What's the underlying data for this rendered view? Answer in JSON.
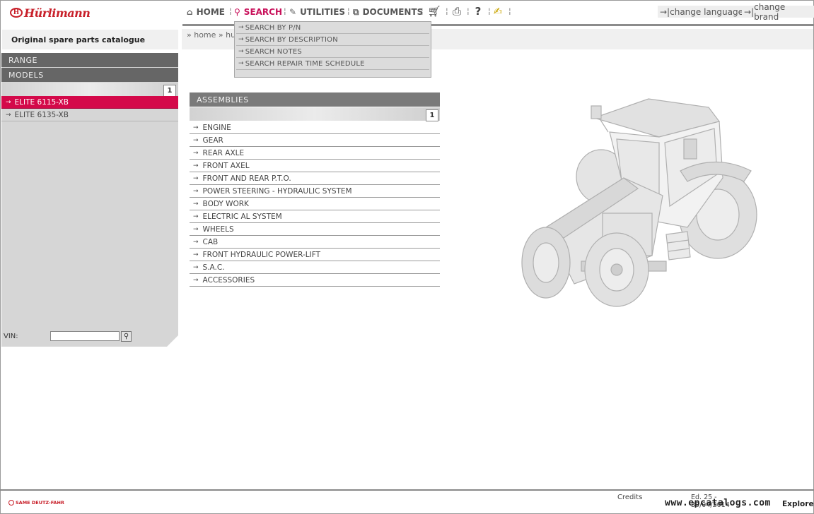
{
  "brand": {
    "logo_text": "Hürlimann",
    "emblem_letter": "H"
  },
  "nav": {
    "home": "HOME",
    "search": "SEARCH",
    "utilities": "UTILITIES",
    "documents": "DOCUMENTS",
    "change_language": "change language",
    "change_brand": "change brand",
    "lang_prefix": "→| ",
    "brand_prefix": "→| "
  },
  "search_menu": [
    "SEARCH BY P/N",
    "SEARCH BY DESCRIPTION",
    "SEARCH NOTES",
    "SEARCH REPAIR TIME SCHEDULE"
  ],
  "breadcrumb": "» home » hu",
  "sidebar": {
    "title": "Original spare parts catalogue",
    "range_label": "RANGE",
    "models_label": "MODELS",
    "page": "1",
    "models": [
      {
        "label": "ELITE 6115-XB",
        "selected": true
      },
      {
        "label": "ELITE 6135-XB",
        "selected": false
      }
    ],
    "vin_label": "VIN:",
    "vin_value": ""
  },
  "assemblies": {
    "header": "ASSEMBLIES",
    "page": "1",
    "items": [
      "ENGINE",
      "GEAR",
      "REAR AXLE",
      "FRONT AXEL",
      "FRONT AND REAR P.T.O.",
      "POWER STEERING - HYDRAULIC SYSTEM",
      "BODY WORK",
      "ELECTRIC AL SYSTEM",
      "WHEELS",
      "CAB",
      "FRONT HYDRAULIC POWER-LIFT",
      "S.A.C.",
      "ACCESSORIES"
    ]
  },
  "footer": {
    "company": "SAME DEUTZ-FAHR",
    "credits": "Credits",
    "edition_line1": "Ed. 25 -",
    "edition_line2": "30/04/2014",
    "watermark": "www.epcatalogs.com",
    "explorer": "Explorer"
  },
  "colors": {
    "accent": "#d4094a",
    "brand": "#c8202a",
    "header_gray": "#666666"
  }
}
